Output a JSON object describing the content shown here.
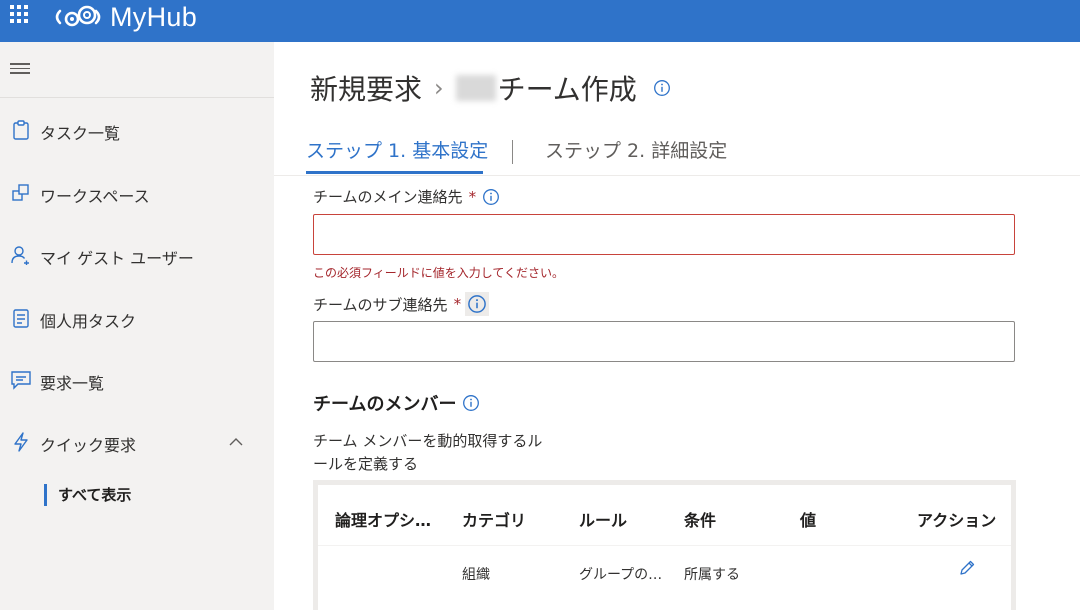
{
  "app": {
    "title": "MyHub",
    "icons": {
      "launcher": "waffle-icon",
      "logo": "gears-logo-icon"
    },
    "colors": {
      "brand": "#2f73c9",
      "error": "#a4262c",
      "sidebar_bg": "#f3f2f1"
    }
  },
  "sidebar": {
    "items": [
      {
        "label": "タスク一覧",
        "icon": "clipboard-icon"
      },
      {
        "label": "ワークスペース",
        "icon": "workspace-icon"
      },
      {
        "label": "マイ ゲスト ユーザー",
        "icon": "guest-user-icon"
      },
      {
        "label": "個人用タスク",
        "icon": "task-list-icon"
      },
      {
        "label": "要求一覧",
        "icon": "chat-icon"
      },
      {
        "label": "クイック要求",
        "icon": "lightning-icon",
        "expanded": true
      }
    ],
    "subitems": [
      {
        "label": "すべて表示",
        "selected": true
      }
    ]
  },
  "main": {
    "breadcrumb": {
      "parent": "新規要求",
      "separator": "›",
      "current": "チーム作成"
    },
    "tabs": [
      {
        "label": "ステップ 1. 基本設定",
        "active": true
      },
      {
        "label": "ステップ 2. 詳細設定",
        "active": false
      }
    ],
    "fields": {
      "main_contact": {
        "label": "チームのメイン連絡先",
        "required_mark": "*",
        "value": "",
        "error": "この必須フィールドに値を入力してください。"
      },
      "sub_contact": {
        "label": "チームのサブ連絡先",
        "required_mark": "*",
        "value": ""
      }
    },
    "members": {
      "title": "チームのメンバー",
      "description": "チーム メンバーを動的取得するルールを定義する",
      "description_lines": [
        "チーム メンバーを動的取得するル",
        "ールを定義する"
      ],
      "table": {
        "headers": [
          "論理オプシ…",
          "カテゴリ",
          "ルール",
          "条件",
          "値",
          "アクション"
        ],
        "rows": [
          {
            "cells": [
              "",
              "組織",
              "グループの…",
              "所属する",
              ""
            ],
            "action_icon": "edit-pencil-icon"
          }
        ]
      }
    }
  }
}
